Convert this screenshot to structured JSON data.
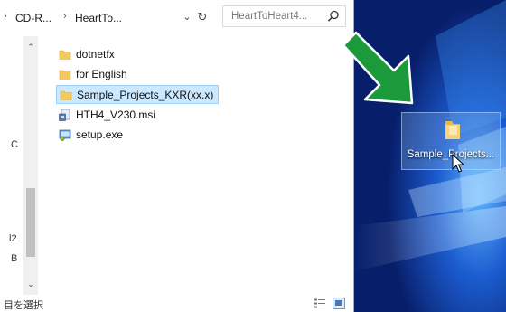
{
  "explorer": {
    "breadcrumbs": {
      "prefix_chevron": "›",
      "item1": "CD-R...",
      "separator": "›",
      "item2": "HeartTo...",
      "dropdown_glyph": "⌄",
      "refresh_glyph": "↻"
    },
    "search": {
      "placeholder": "HeartToHeart4..."
    },
    "nav_pane_edge_chars": [
      "C",
      "l2",
      "B"
    ],
    "scrollbar": {
      "up_glyph": "⌃",
      "down_glyph": "⌄"
    },
    "files": [
      {
        "name": "dotnetfx",
        "icon": "folder-icon",
        "selected": false
      },
      {
        "name": "for English",
        "icon": "folder-icon",
        "selected": false
      },
      {
        "name": "Sample_Projects_KXR(xx.x)",
        "icon": "folder-icon",
        "selected": true
      },
      {
        "name": "HTH4_V230.msi",
        "icon": "msi-installer-icon",
        "selected": false
      },
      {
        "name": "setup.exe",
        "icon": "setup-exe-icon",
        "selected": false
      }
    ],
    "status": {
      "text": "目を選択"
    }
  },
  "desktop": {
    "icon_label": "Sample_Projects..."
  },
  "colors": {
    "selection_bg": "#cce8ff",
    "selection_border": "#99d1ff",
    "folder_yellow": "#f4c95d",
    "arrow_green": "#1a9a3a",
    "desktop_blue": "#0a2f8c"
  }
}
